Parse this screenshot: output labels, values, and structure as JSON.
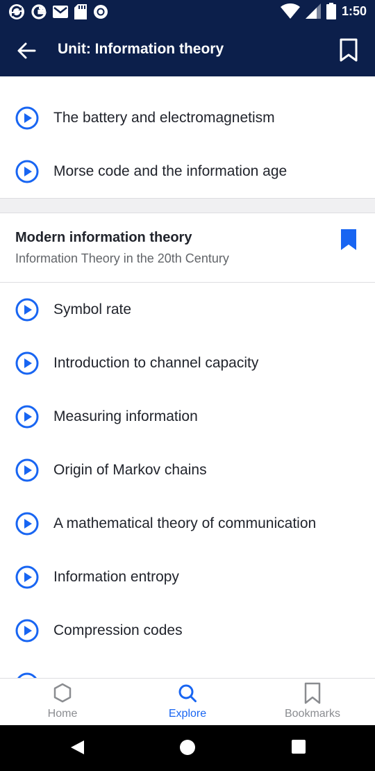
{
  "status_bar": {
    "time": "1:50",
    "left_icons": [
      "sync-icon",
      "google-icon",
      "gmail-icon",
      "sd-card-icon",
      "record-icon"
    ],
    "right_icons": [
      "wifi-icon",
      "signal-icon",
      "battery-icon"
    ]
  },
  "app_bar": {
    "title": "Unit: Information theory"
  },
  "lessons_top": [
    {
      "label": "The battery and electromagnetism"
    },
    {
      "label": "Morse code and the information age"
    }
  ],
  "section": {
    "title": "Modern information theory",
    "subtitle": "Information Theory in the 20th Century"
  },
  "lessons": [
    {
      "label": "Symbol rate"
    },
    {
      "label": "Introduction to channel capacity"
    },
    {
      "label": "Measuring information"
    },
    {
      "label": "Origin of Markov chains"
    },
    {
      "label": "A mathematical theory of communication"
    },
    {
      "label": "Information entropy"
    },
    {
      "label": "Compression codes"
    }
  ],
  "bottom_nav": {
    "items": [
      {
        "label": "Home",
        "icon": "home-icon"
      },
      {
        "label": "Explore",
        "icon": "search-icon",
        "active": true
      },
      {
        "label": "Bookmarks",
        "icon": "bookmark-icon"
      }
    ]
  },
  "colors": {
    "header_bg": "#0c1f4b",
    "accent": "#1865f2",
    "text": "#21242c",
    "muted": "#626569"
  }
}
